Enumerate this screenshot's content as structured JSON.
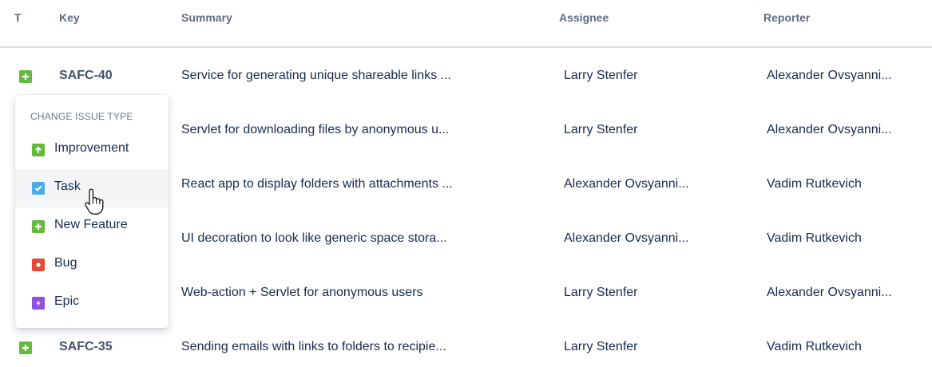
{
  "columns": {
    "type": "T",
    "key": "Key",
    "summary": "Summary",
    "assignee": "Assignee",
    "reporter": "Reporter"
  },
  "rows": [
    {
      "key": "SAFC-40",
      "summary": "Service for generating unique shareable links ...",
      "assignee": "Larry Stenfer",
      "reporter": "Alexander Ovsyanni..."
    },
    {
      "key": "",
      "summary": "Servlet for downloading files by anonymous u...",
      "assignee": "Larry Stenfer",
      "reporter": "Alexander Ovsyanni..."
    },
    {
      "key": "",
      "summary": "React app to display folders with attachments ...",
      "assignee": "Alexander Ovsyanni...",
      "reporter": "Vadim Rutkevich"
    },
    {
      "key": "",
      "summary": "UI decoration to look like generic space stora...",
      "assignee": "Alexander Ovsyanni...",
      "reporter": "Vadim Rutkevich"
    },
    {
      "key": "",
      "summary": "Web-action + Servlet for anonymous users",
      "assignee": "Larry Stenfer",
      "reporter": "Alexander Ovsyanni..."
    },
    {
      "key": "SAFC-35",
      "summary": "Sending emails with links to folders to recipie...",
      "assignee": "Larry Stenfer",
      "reporter": "Vadim Rutkevich"
    }
  ],
  "menu": {
    "title": "CHANGE ISSUE TYPE",
    "items": [
      {
        "label": "Improvement",
        "icon": "arrow-up-icon",
        "color": "#63ba3c"
      },
      {
        "label": "Task",
        "icon": "check-icon",
        "color": "#4bade8"
      },
      {
        "label": "New Feature",
        "icon": "plus-icon",
        "color": "#63ba3c"
      },
      {
        "label": "Bug",
        "icon": "bug-dot-icon",
        "color": "#e5493a"
      },
      {
        "label": "Epic",
        "icon": "bolt-icon",
        "color": "#904ee2"
      }
    ]
  },
  "issue_type_color": "#63ba3c"
}
